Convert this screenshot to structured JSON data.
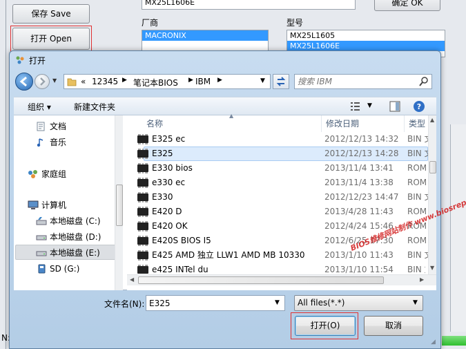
{
  "background_app": {
    "save_button": "保存 Save",
    "open_button": "打开 Open",
    "chip_model_value": "MX25L1606E",
    "confirm_button": "确定 OK",
    "vendor_label": "厂商",
    "model_label": "型号",
    "vendor_list": [
      "MACRONIX"
    ],
    "model_list": [
      "MX25L1605",
      "MX25L1606E"
    ],
    "status_prefix": "N:"
  },
  "dialog": {
    "title": "打开",
    "breadcrumb": [
      "«",
      "12345",
      "笔记本BIOS",
      "IBM"
    ],
    "search_placeholder": "搜索 IBM",
    "toolbar": {
      "organize": "组织 ▾",
      "new_folder": "新建文件夹"
    },
    "nav": {
      "items": [
        {
          "label": "文档",
          "icon": "document-icon"
        },
        {
          "label": "音乐",
          "icon": "music-icon"
        },
        {
          "label": "家庭组",
          "icon": "homegroup-icon"
        },
        {
          "label": "计算机",
          "icon": "computer-icon"
        },
        {
          "label": "本地磁盘 (C:)",
          "icon": "drive-icon"
        },
        {
          "label": "本地磁盘 (D:)",
          "icon": "drive-icon"
        },
        {
          "label": "本地磁盘 (E:)",
          "icon": "drive-icon"
        },
        {
          "label": "SD (G:)",
          "icon": "drive-icon"
        }
      ]
    },
    "columns": {
      "name": "名称",
      "date": "修改日期",
      "type": "类型"
    },
    "files": [
      {
        "name": "E325 ec",
        "date": "2012/12/13 14:32",
        "type": "BIN 文"
      },
      {
        "name": "E325",
        "date": "2012/12/13 14:28",
        "type": "BIN 文"
      },
      {
        "name": "E330 bios",
        "date": "2013/11/4 13:41",
        "type": "ROM"
      },
      {
        "name": "e330 ec",
        "date": "2013/11/4 13:38",
        "type": "ROM"
      },
      {
        "name": "E330",
        "date": "2012/12/23 14:47",
        "type": "BIN 文"
      },
      {
        "name": "E420 D",
        "date": "2013/4/28 11:43",
        "type": "ROM"
      },
      {
        "name": "E420 OK",
        "date": "2012/4/24 15:46",
        "type": "ROM"
      },
      {
        "name": "E420S BIOS I5",
        "date": "2012/6/25 17:30",
        "type": "ROM"
      },
      {
        "name": "E425 AMD 独立 LLW1 AMD MB 10330",
        "date": "2013/1/10 11:43",
        "type": "BIN 文"
      },
      {
        "name": "e425 INTel du",
        "date": "2013/1/10 11:54",
        "type": "BIN 文"
      }
    ],
    "filename_label": "文件名(N):",
    "filename_value": "E325",
    "filter_value": "All files(*.*)",
    "open_button": "打开(O)",
    "cancel_button": "取消"
  },
  "watermark": "BIOS维修网站制作 www.biosrepair.com",
  "colors": {
    "accent": "#3399ff",
    "highlight_red": "#e03030",
    "selection": "#dcebfc"
  }
}
